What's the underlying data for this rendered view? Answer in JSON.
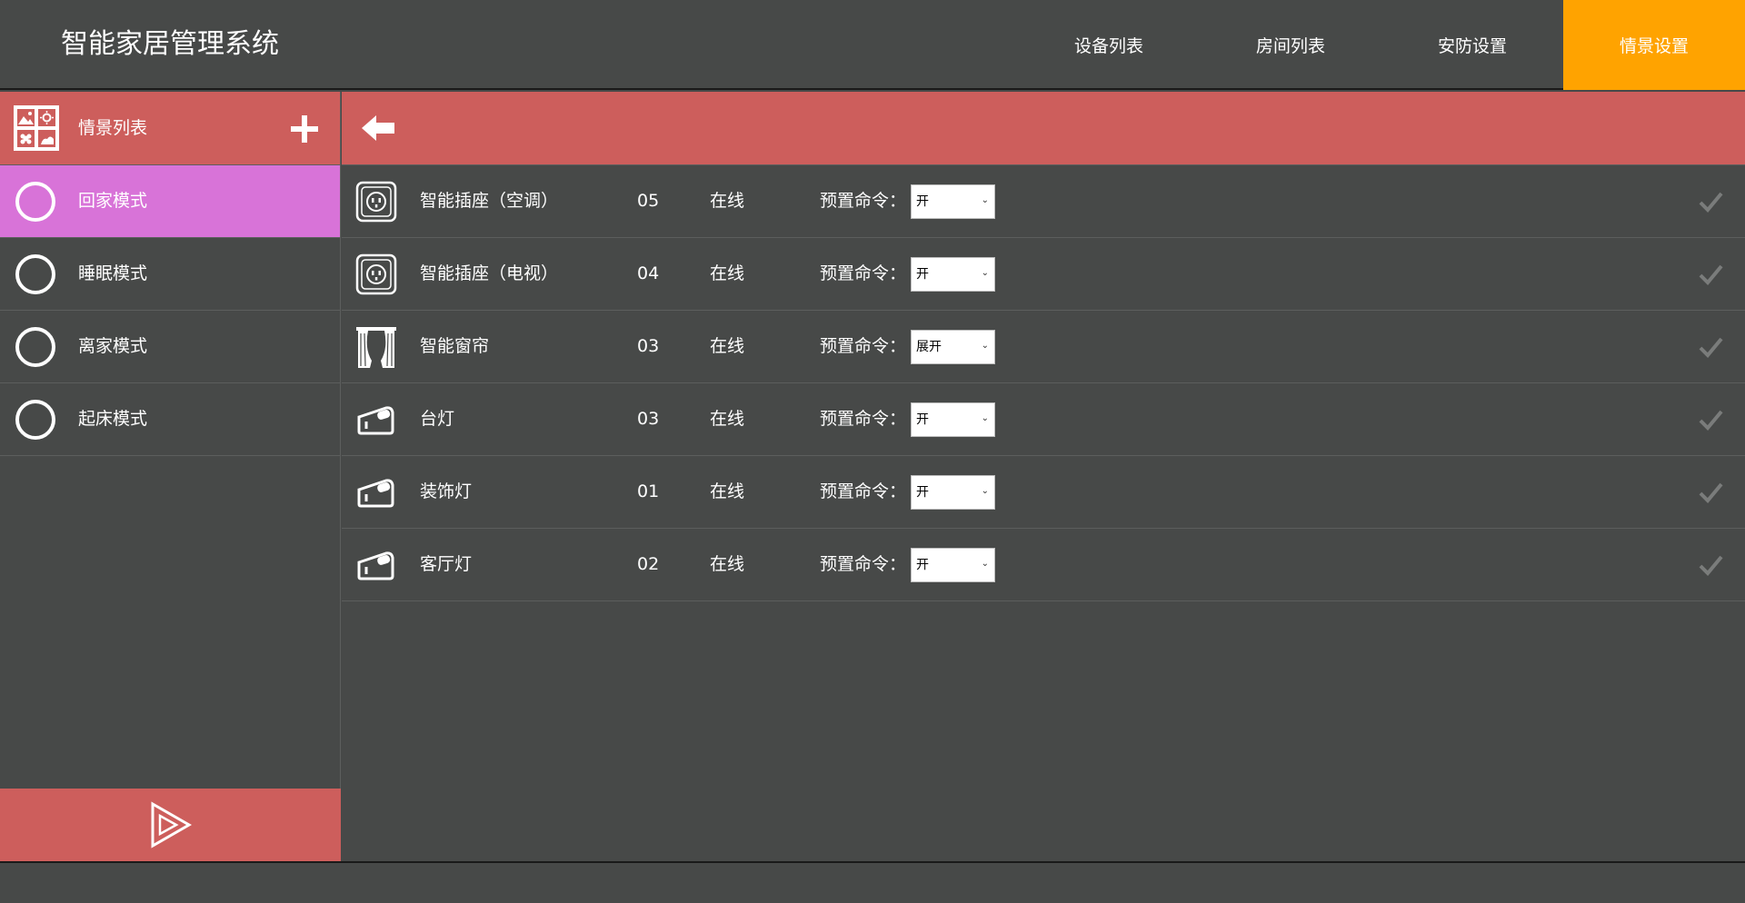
{
  "app": {
    "title": "智能家居管理系统"
  },
  "nav": {
    "tabs": [
      {
        "label": "设备列表",
        "active": false
      },
      {
        "label": "房间列表",
        "active": false
      },
      {
        "label": "安防设置",
        "active": false
      },
      {
        "label": "情景设置",
        "active": true
      }
    ],
    "active_color": "#ffa300"
  },
  "sidebar": {
    "title": "情景列表",
    "header_color": "#cd5e5c",
    "active_color": "#d873d8",
    "scenes": [
      {
        "label": "回家模式",
        "active": true
      },
      {
        "label": "睡眠模式",
        "active": false
      },
      {
        "label": "离家模式",
        "active": false
      },
      {
        "label": "起床模式",
        "active": false
      }
    ]
  },
  "devices": [
    {
      "icon": "socket-icon",
      "name": "智能插座（空调）",
      "number": "05",
      "status": "在线",
      "command_label": "预置命令：",
      "command": "开"
    },
    {
      "icon": "socket-icon",
      "name": "智能插座（电视）",
      "number": "04",
      "status": "在线",
      "command_label": "预置命令：",
      "command": "开"
    },
    {
      "icon": "curtain-icon",
      "name": "智能窗帘",
      "number": "03",
      "status": "在线",
      "command_label": "预置命令：",
      "command": "展开"
    },
    {
      "icon": "switch-icon",
      "name": "台灯",
      "number": "03",
      "status": "在线",
      "command_label": "预置命令：",
      "command": "开"
    },
    {
      "icon": "switch-icon",
      "name": "装饰灯",
      "number": "01",
      "status": "在线",
      "command_label": "预置命令：",
      "command": "开"
    },
    {
      "icon": "switch-icon",
      "name": "客厅灯",
      "number": "02",
      "status": "在线",
      "command_label": "预置命令：",
      "command": "开"
    }
  ]
}
